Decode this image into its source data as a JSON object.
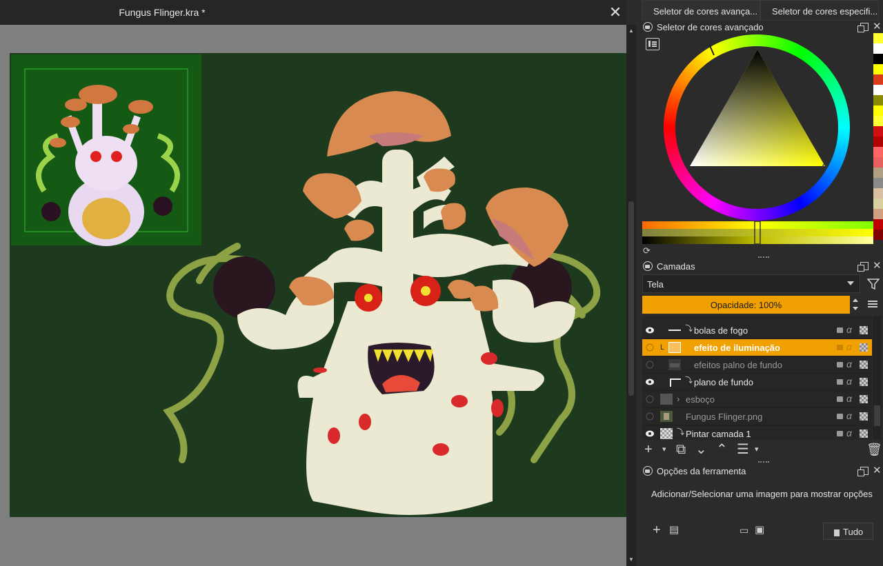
{
  "document": {
    "title": "Fungus Flinger.kra *",
    "close_icon": "close-icon"
  },
  "color_tabs": [
    {
      "label": "Seletor de cores avança...",
      "active": true
    },
    {
      "label": "Seletor de cores especifi...",
      "active": false
    }
  ],
  "color_panel": {
    "title": "Seletor de cores avançado",
    "swatches": [
      "#ffff33",
      "#ffffff",
      "#000000",
      "#ffff00",
      "#d93b1a",
      "#ffffff",
      "#8a8a00",
      "#ffff00",
      "#ffff33",
      "#d01010",
      "#b00000",
      "#ff6666",
      "#e86060",
      "#b0a080",
      "#8a8a8a",
      "#d8c0a0",
      "#d8d0a0",
      "#d0a080",
      "#c00000",
      "#800000"
    ],
    "hue_ring": "conic",
    "selected_color": "#ffff33"
  },
  "layers_panel": {
    "title": "Camadas",
    "blend_mode": "Tela",
    "opacity_label": "Opacidade:  100%",
    "layers": [
      {
        "name": "bolas de fogo",
        "visible": true,
        "selected": false,
        "dim": false,
        "thumb": "line"
      },
      {
        "name": "efeito de iluminação",
        "visible": false,
        "selected": true,
        "dim": false,
        "thumb": "orange"
      },
      {
        "name": "efeitos palno de fundo",
        "visible": false,
        "selected": false,
        "dim": true,
        "thumb": "dark"
      },
      {
        "name": "plano de fundo",
        "visible": true,
        "selected": false,
        "dim": false,
        "thumb": "corner"
      },
      {
        "name": "esboço",
        "visible": false,
        "selected": false,
        "dim": true,
        "thumb": "gray"
      },
      {
        "name": "Fungus Flinger.png",
        "visible": false,
        "selected": false,
        "dim": true,
        "thumb": "image"
      },
      {
        "name": "Pintar camada 1",
        "visible": true,
        "selected": false,
        "dim": false,
        "thumb": "checker"
      }
    ]
  },
  "tool_options": {
    "title": "Opções da ferramenta",
    "hint": "Adicionar/Selecionar uma imagem para mostrar opções",
    "all_button": "Tudo"
  },
  "colors": {
    "accent": "#f0a000",
    "canvas_bg": "#1e3a1e",
    "panel_bg": "#2b2b2b"
  }
}
